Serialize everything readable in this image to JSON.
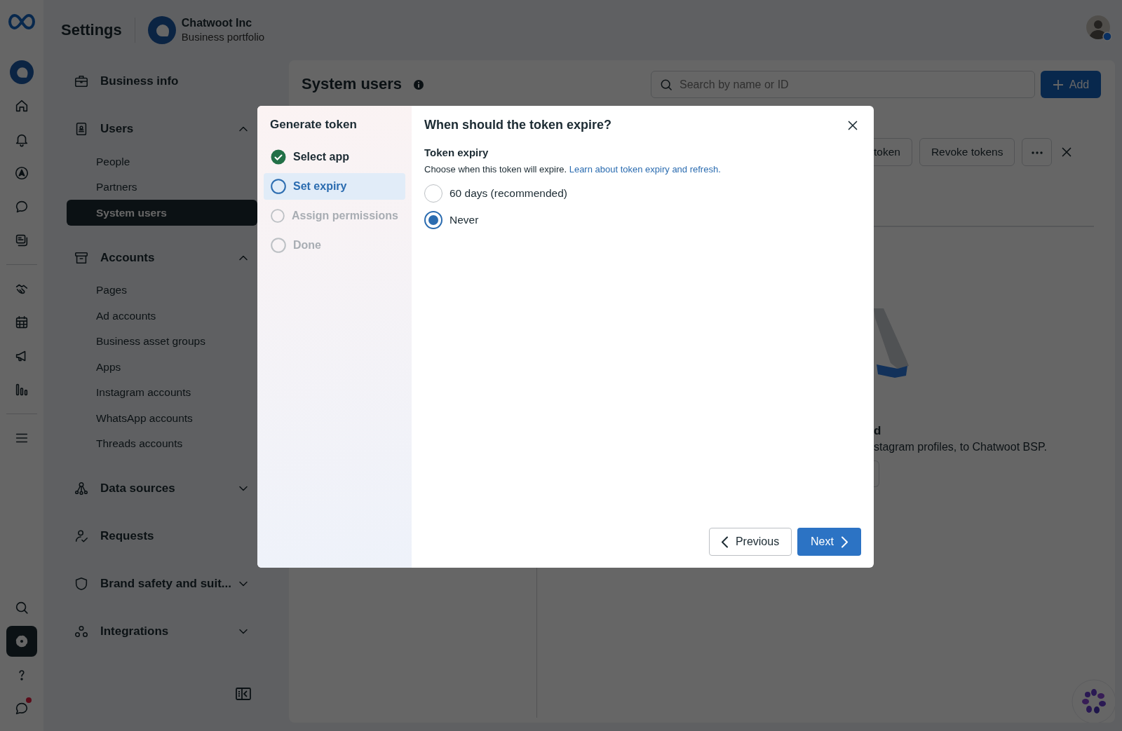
{
  "header": {
    "title": "Settings",
    "business_name": "Chatwoot Inc",
    "business_subtitle": "Business portfolio"
  },
  "rail": {
    "groups": [
      [
        {
          "kind": "business",
          "selected": false
        },
        {
          "kind": "home",
          "selected": false
        },
        {
          "kind": "bell",
          "selected": false
        },
        {
          "kind": "compass",
          "selected": false
        },
        {
          "kind": "chat",
          "selected": false
        },
        {
          "kind": "pages",
          "selected": false
        }
      ],
      [
        {
          "kind": "handshake",
          "selected": false
        },
        {
          "kind": "calendar",
          "selected": false
        },
        {
          "kind": "megaphone",
          "selected": false
        },
        {
          "kind": "chart",
          "selected": false
        }
      ],
      [
        {
          "kind": "menu",
          "selected": false
        }
      ]
    ],
    "bottom": [
      {
        "kind": "search",
        "selected": false,
        "notification": false
      },
      {
        "kind": "settings",
        "selected": true,
        "notification": false
      },
      {
        "kind": "help",
        "selected": false,
        "notification": false
      },
      {
        "kind": "feedback",
        "selected": false,
        "notification": true
      }
    ]
  },
  "sidebar": [
    {
      "label": "Business info",
      "kind": "briefcase"
    },
    {
      "label": "Users",
      "kind": "badge",
      "expanded": true,
      "children": [
        {
          "label": "People",
          "selected": false
        },
        {
          "label": "Partners",
          "selected": false
        },
        {
          "label": "System users",
          "selected": true
        }
      ]
    },
    {
      "label": "Accounts",
      "kind": "archive",
      "expanded": true,
      "children": [
        {
          "label": "Pages",
          "selected": false
        },
        {
          "label": "Ad accounts",
          "selected": false
        },
        {
          "label": "Business asset groups",
          "selected": false
        },
        {
          "label": "Apps",
          "selected": false
        },
        {
          "label": "Instagram accounts",
          "selected": false
        },
        {
          "label": "WhatsApp accounts",
          "selected": false
        },
        {
          "label": "Threads accounts",
          "selected": false
        }
      ]
    },
    {
      "label": "Data sources",
      "kind": "nodes",
      "expanded": false
    },
    {
      "label": "Requests",
      "kind": "person"
    },
    {
      "label": "Brand safety and suit...",
      "kind": "shield",
      "expanded": false
    },
    {
      "label": "Integrations",
      "kind": "cluster",
      "expanded": false
    }
  ],
  "main": {
    "title": "System users",
    "search": {
      "placeholder": "Search by name or ID"
    },
    "add_button": "Add",
    "actions": [
      "token",
      "Revoke tokens"
    ],
    "empty_state": {
      "heading": "d",
      "text": "stagram profiles, to Chatwoot BSP."
    }
  },
  "dialog": {
    "title": "Generate token",
    "steps": [
      {
        "label": "Select app",
        "completed": true,
        "selected": false
      },
      {
        "label": "Set expiry",
        "completed": false,
        "selected": true
      },
      {
        "label": "Assign permissions",
        "completed": false,
        "selected": false
      },
      {
        "label": "Done",
        "completed": false,
        "selected": false
      }
    ],
    "heading": "When should the token expire?",
    "field_label": "Token expiry",
    "description": "Choose when this token will expire.",
    "link": "Learn about token expiry and refresh.",
    "options": [
      {
        "label": "60 days (recommended)",
        "selected": false
      },
      {
        "label": "Never",
        "selected": true
      }
    ],
    "buttons": {
      "previous": "Previous",
      "next": "Next"
    }
  }
}
